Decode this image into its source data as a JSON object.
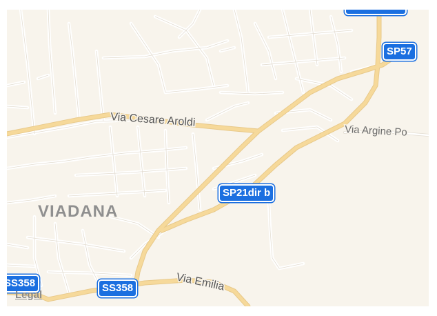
{
  "map": {
    "town_label": "VIADANA",
    "streets": {
      "via_cesare_aroldi": "Via Cesare Aroldi",
      "via_argine_po": "Via Argine Po",
      "via_emilia": "Via Emilia"
    },
    "shields": {
      "sp57": "SP57",
      "sp21dir_b": "SP21dir b",
      "ss358_left": "SS358",
      "ss358_center": "SS358"
    },
    "legal_link": "Legal"
  },
  "colors": {
    "background": "#f8f4ec",
    "minor_road": "#e3ddd2",
    "major_road": "#f6d99a",
    "shield_fill": "#1b6fe0"
  }
}
